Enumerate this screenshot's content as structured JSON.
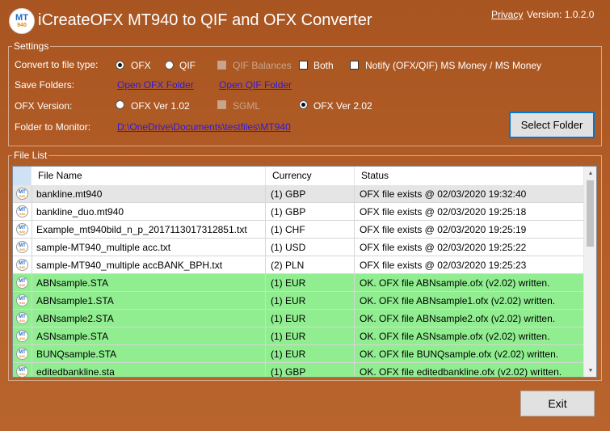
{
  "app": {
    "logo_line1": "MT",
    "logo_line2": "940",
    "title": "iCreateOFX MT940 to QIF and OFX Converter",
    "privacy_link": "Privacy",
    "version": "Version: 1.0.2.0"
  },
  "settings": {
    "legend": "Settings",
    "convert_label": "Convert to file type:",
    "opt_ofx": "OFX",
    "opt_qif": "QIF",
    "qif_balances": "QIF Balances",
    "both": "Both",
    "notify": "Notify (OFX/QIF) MS Money / MS Money",
    "save_folders_label": "Save Folders:",
    "open_ofx_folder": "Open OFX Folder",
    "open_qif_folder": "Open QIF Folder",
    "ofx_version_label": "OFX Version:",
    "ver_102": "OFX Ver 1.02",
    "sgml": "SGML",
    "ver_202": "OFX Ver 2.02",
    "folder_monitor_label": "Folder to Monitor:",
    "folder_path": "D:\\OneDrive\\Documents\\testfiles\\MT940",
    "select_folder_button": "Select Folder",
    "selected_type": "OFX",
    "selected_version": "OFX Ver 2.02"
  },
  "file_list": {
    "legend": "File List",
    "columns": [
      "",
      "File Name",
      "Currency",
      "Status"
    ],
    "rows": [
      {
        "name": "bankline.mt940",
        "currency": "(1) GBP",
        "status": "OFX file exists @ 02/03/2020 19:32:40",
        "state": "selected"
      },
      {
        "name": "bankline_duo.mt940",
        "currency": "(1) GBP",
        "status": "OFX file exists @ 02/03/2020 19:25:18",
        "state": "normal"
      },
      {
        "name": "Example_mt940bild_n_p_20171130173128​51.txt",
        "currency": "(1) CHF",
        "status": "OFX file exists @ 02/03/2020 19:25:19",
        "state": "normal"
      },
      {
        "name": "sample-MT940_multiple acc.txt",
        "currency": "(1) USD",
        "status": "OFX file exists @ 02/03/2020 19:25:22",
        "state": "normal"
      },
      {
        "name": "sample-MT940_multiple accBANK_BPH.txt",
        "currency": "(2) PLN",
        "status": "OFX file exists @ 02/03/2020 19:25:23",
        "state": "normal"
      },
      {
        "name": "ABNsample.STA",
        "currency": "(1) EUR",
        "status": "OK. OFX file ABNsample.ofx (v2.02) written.",
        "state": "ok"
      },
      {
        "name": "ABNsample1.STA",
        "currency": "(1) EUR",
        "status": "OK. OFX file ABNsample1.ofx (v2.02) written.",
        "state": "ok"
      },
      {
        "name": "ABNsample2.STA",
        "currency": "(1) EUR",
        "status": "OK. OFX file ABNsample2.ofx (v2.02) written.",
        "state": "ok"
      },
      {
        "name": "ASNsample.STA",
        "currency": "(1) EUR",
        "status": "OK. OFX file ASNsample.ofx (v2.02) written.",
        "state": "ok"
      },
      {
        "name": "BUNQsample.STA",
        "currency": "(1) EUR",
        "status": "OK. OFX file BUNQsample.ofx (v2.02) written.",
        "state": "ok"
      },
      {
        "name": "editedbankline.sta",
        "currency": "(1) GBP",
        "status": "OK. OFX file editedbankline.ofx (v2.02) written.",
        "state": "ok"
      }
    ]
  },
  "footer": {
    "exit_button": "Exit"
  },
  "colors": {
    "background": "#b15c26",
    "ok_row": "#90ee90",
    "selected_row": "#e5e5e5",
    "link": "#2a1bdc"
  }
}
